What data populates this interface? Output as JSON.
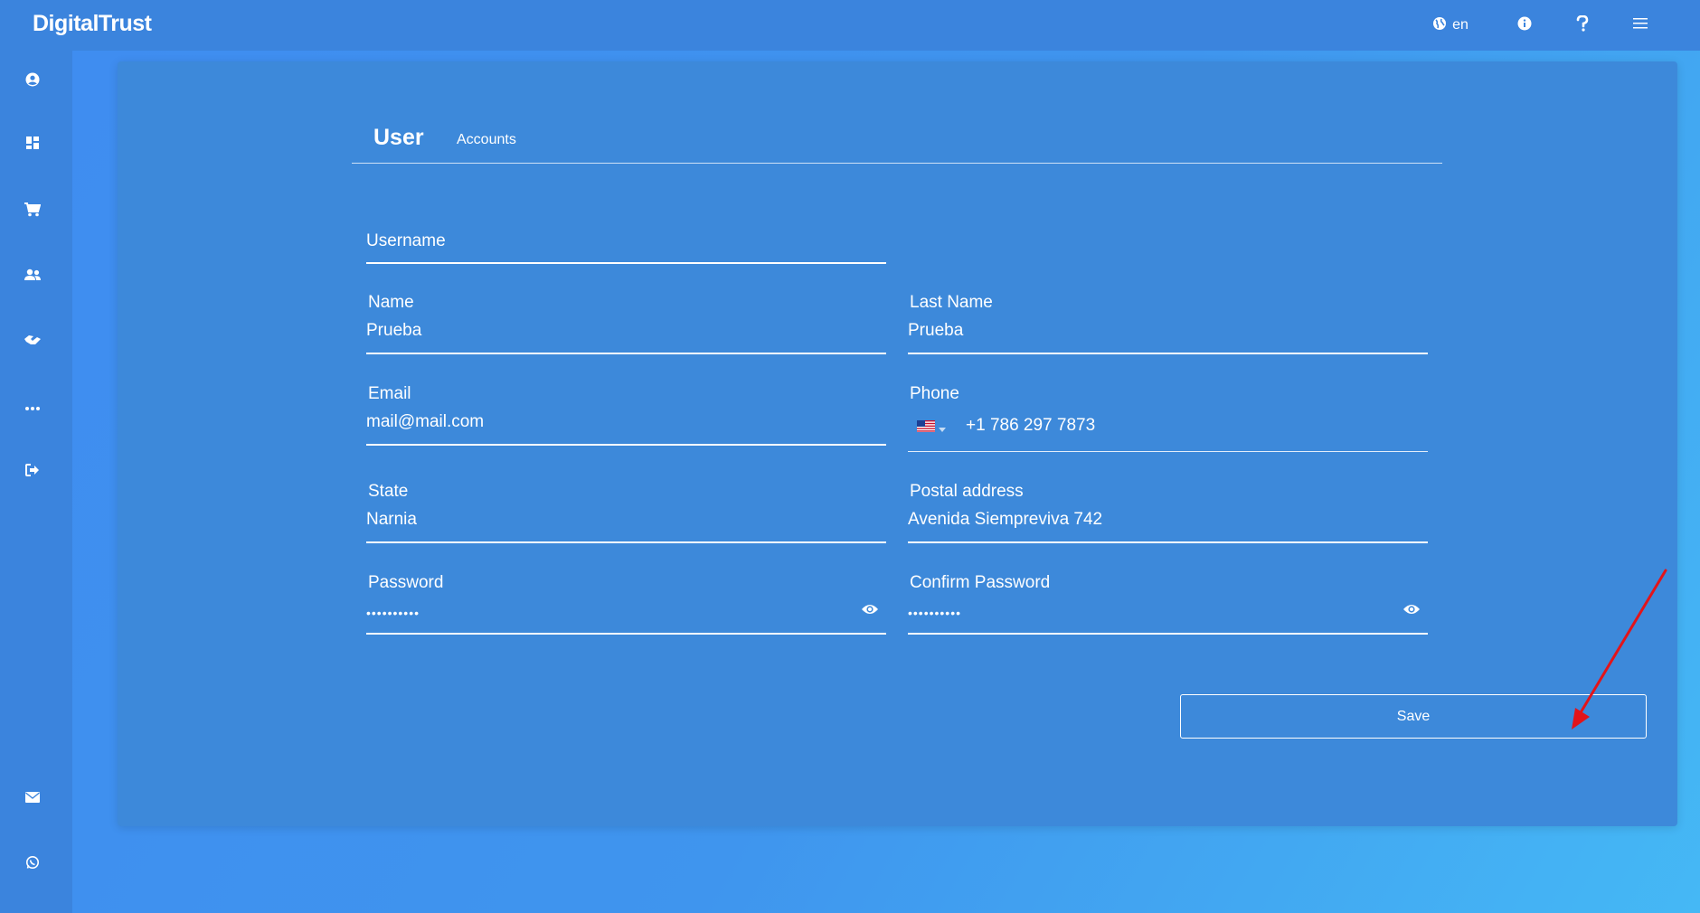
{
  "app": {
    "title": "DigitalTrust"
  },
  "header": {
    "language": "en",
    "icons": [
      "globe-icon",
      "info-icon",
      "help-icon",
      "menu-icon"
    ]
  },
  "sidebar": {
    "icons": [
      "user-icon",
      "dashboard-icon",
      "cart-icon",
      "users-icon",
      "handshake-icon",
      "more-icon",
      "logout-icon",
      "mail-icon",
      "whatsapp-icon"
    ]
  },
  "tabs": {
    "user": "User",
    "accounts": "Accounts"
  },
  "form": {
    "username": {
      "placeholder": "Username",
      "value": ""
    },
    "name": {
      "label": "Name",
      "value": "Prueba"
    },
    "last_name": {
      "label": "Last Name",
      "value": "Prueba"
    },
    "email": {
      "label": "Email",
      "value": "mail@mail.com"
    },
    "phone": {
      "label": "Phone",
      "value": "+1 786 297 7873",
      "country": "US"
    },
    "state": {
      "label": "State",
      "value": "Narnia"
    },
    "postal_address": {
      "label": "Postal address",
      "value": "Avenida Siempreviva 742"
    },
    "password": {
      "label": "Password",
      "value": "••••••••••"
    },
    "confirm_password": {
      "label": "Confirm Password",
      "value": "••••••••••"
    }
  },
  "actions": {
    "save": "Save"
  },
  "colors": {
    "accent": "#3b84dd",
    "arrow": "#e3141a"
  }
}
